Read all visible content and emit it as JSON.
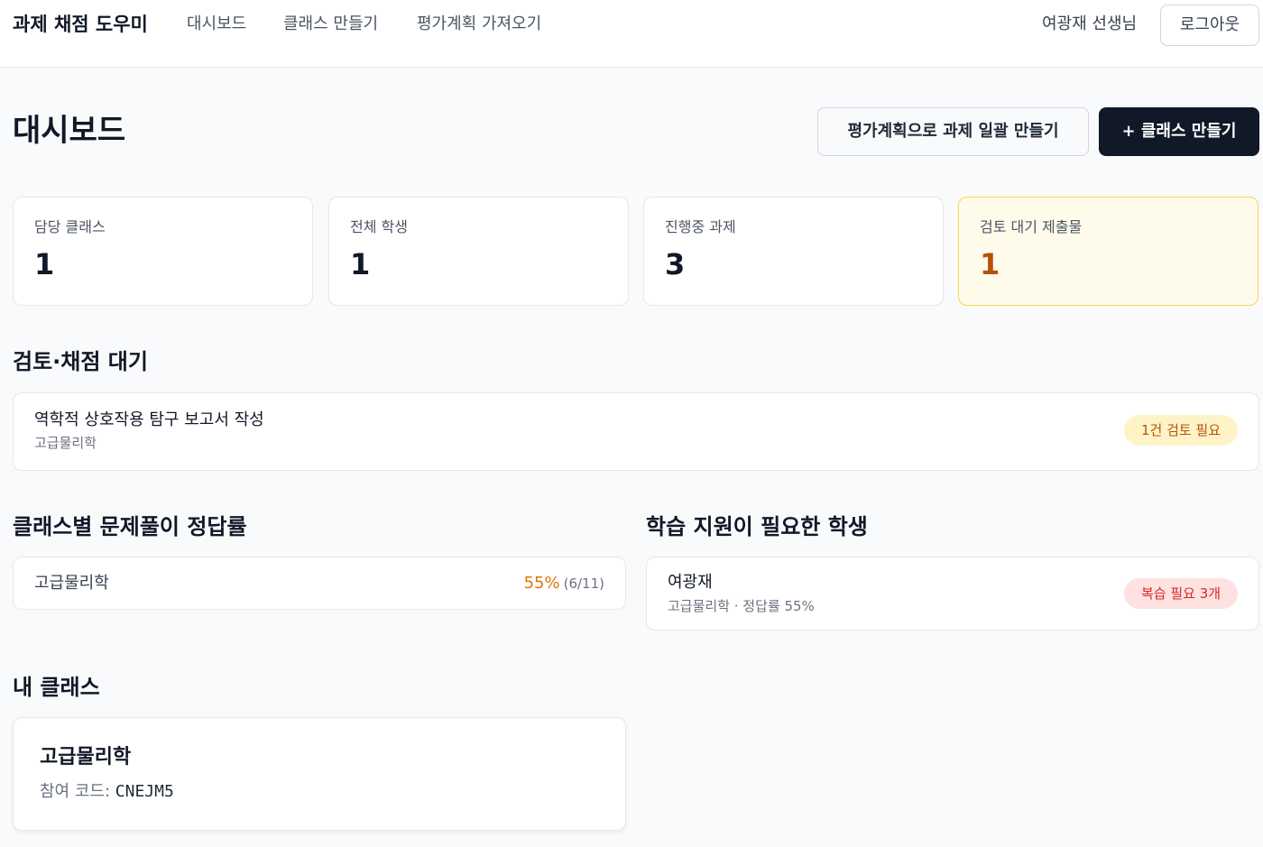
{
  "nav": {
    "brand": "과제 채점 도우미",
    "links": [
      "대시보드",
      "클래스 만들기",
      "평가계획 가져오기"
    ],
    "user": "여광재 선생님",
    "logout": "로그아웃"
  },
  "header": {
    "title": "대시보드",
    "import_button": "평가계획으로 과제 일괄 만들기",
    "create_button": "+ 클래스 만들기"
  },
  "stats": [
    {
      "label": "담당 클래스",
      "value": "1"
    },
    {
      "label": "전체 학생",
      "value": "1"
    },
    {
      "label": "진행중 과제",
      "value": "3"
    },
    {
      "label": "검토 대기 제출물",
      "value": "1"
    }
  ],
  "review": {
    "heading": "검토·채점 대기",
    "items": [
      {
        "title": "역학적 상호작용 탐구 보고서 작성",
        "class": "고급물리학",
        "badge": "1건 검토 필요"
      }
    ]
  },
  "rates": {
    "heading": "클래스별 문제풀이 정답률",
    "items": [
      {
        "class": "고급물리학",
        "percent": "55%",
        "count": "(6/11)"
      }
    ]
  },
  "support": {
    "heading": "학습 지원이 필요한 학생",
    "items": [
      {
        "name": "여광재",
        "detail": "고급물리학 · 정답률 55%",
        "badge": "복습 필요 3개"
      }
    ]
  },
  "classes": {
    "heading": "내 클래스",
    "items": [
      {
        "name": "고급물리학",
        "code_label": "참여 코드:",
        "code": "CNEJM5"
      }
    ]
  },
  "colors": {
    "primary_dark": "#111827",
    "warning": "#b45309",
    "rate_orange": "#d97706",
    "danger": "#dc2626"
  }
}
